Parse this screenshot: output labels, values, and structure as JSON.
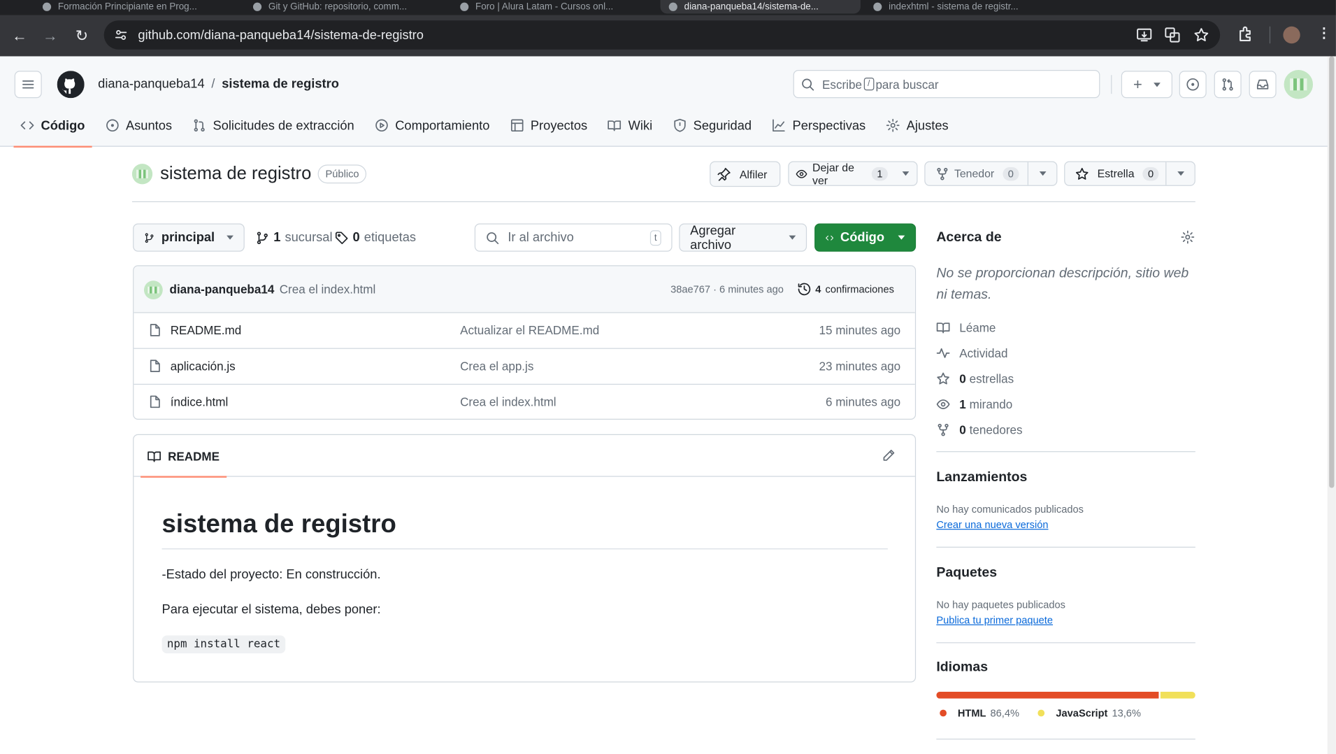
{
  "browser": {
    "tabs": [
      {
        "title": "Formación Principiante en Prog..."
      },
      {
        "title": "Git y GitHub: repositorio, comm..."
      },
      {
        "title": "Foro | Alura Latam - Cursos onl..."
      },
      {
        "title": "diana-panqueba14/sistema-de..."
      },
      {
        "title": "indexhtml - sistema de registr..."
      }
    ],
    "url": "github.com/diana-panqueba14/sistema-de-registro"
  },
  "header": {
    "owner": "diana-panqueba14",
    "separator": "/",
    "repo": "sistema de registro",
    "search_prefix": "Escribe",
    "search_key": "/",
    "search_suffix": "para buscar",
    "plus": "+"
  },
  "nav": {
    "tabs": [
      {
        "label": "Código"
      },
      {
        "label": "Asuntos"
      },
      {
        "label": "Solicitudes de extracción"
      },
      {
        "label": "Comportamiento"
      },
      {
        "label": "Proyectos"
      },
      {
        "label": "Wiki"
      },
      {
        "label": "Seguridad"
      },
      {
        "label": "Perspectivas"
      },
      {
        "label": "Ajustes"
      }
    ]
  },
  "repo_header": {
    "title": "sistema de registro",
    "visibility": "Público",
    "pin_label": "Alfiler",
    "watch_label": "Dejar de ver",
    "watch_count": "1",
    "fork_label": "Tenedor",
    "fork_count": "0",
    "star_label": "Estrella",
    "star_count": "0"
  },
  "toolbar": {
    "branch": "principal",
    "branches_count": "1",
    "branches_label": "sucursal",
    "tags_count": "0",
    "tags_label": "etiquetas",
    "goto_placeholder": "Ir al archivo",
    "goto_key": "t",
    "add_file": "Agregar archivo",
    "code": "Código"
  },
  "commit": {
    "author": "diana-panqueba14",
    "message": "Crea el index.html",
    "hash_time": "38ae767 · 6 minutes ago",
    "count": "4",
    "count_label": "confirmaciones"
  },
  "files": [
    {
      "name": "README.md",
      "message": "Actualizar el README.md",
      "age": "15 minutes ago"
    },
    {
      "name": "aplicación.js",
      "message": "Crea el app.js",
      "age": "23 minutes ago"
    },
    {
      "name": "índice.html",
      "message": "Crea el index.html",
      "age": "6 minutes ago"
    }
  ],
  "readme": {
    "tab": "README",
    "heading": "sistema de registro",
    "status": "-Estado del proyecto: En construcción.",
    "instructions": "Para ejecutar el sistema, debes poner:",
    "code": "npm install react"
  },
  "about": {
    "title": "Acerca de",
    "description": "No se proporcionan descripción, sitio web ni temas.",
    "readme": "Léame",
    "activity": "Actividad",
    "stars_count": "0",
    "stars_label": "estrellas",
    "watching_count": "1",
    "watching_label": "mirando",
    "forks_count": "0",
    "forks_label": "tenedores"
  },
  "releases": {
    "title": "Lanzamientos",
    "empty": "No hay comunicados publicados",
    "link": "Crear una nueva versión"
  },
  "packages": {
    "title": "Paquetes",
    "empty": "No hay paquetes publicados",
    "link": "Publica tu primer paquete"
  },
  "languages": {
    "title": "Idiomas",
    "items": [
      {
        "name": "HTML",
        "percent": "86,4%",
        "share": 86.4,
        "color": "#e34c26"
      },
      {
        "name": "JavaScript",
        "percent": "13,6%",
        "share": 13.6,
        "color": "#f1e05a"
      }
    ]
  },
  "colors": {
    "accent_green": "#1f883d",
    "link": "#0969da",
    "tab_underline": "#fd8c73"
  }
}
